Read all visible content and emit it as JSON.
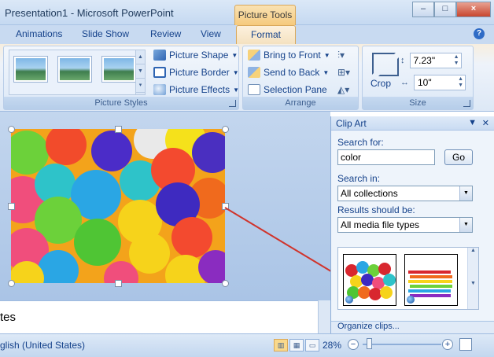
{
  "window": {
    "title": "Presentation1 - Microsoft PowerPoint",
    "context_tab": "Picture Tools",
    "controls": [
      "–",
      "□",
      "×"
    ]
  },
  "tabs": [
    "Animations",
    "Slide Show",
    "Review",
    "View",
    "Format"
  ],
  "active_tab": "Format",
  "ribbon": {
    "picture_styles": {
      "label": "Picture Styles",
      "buttons": [
        "Picture Shape",
        "Picture Border",
        "Picture Effects"
      ]
    },
    "arrange": {
      "label": "Arrange",
      "buttons": [
        "Bring to Front",
        "Send to Back",
        "Selection Pane"
      ]
    },
    "size": {
      "label": "Size",
      "crop_label": "Crop",
      "height_value": "7.23\"",
      "width_value": "10\""
    }
  },
  "notes_text": "tes",
  "clip_art": {
    "title": "Clip Art",
    "search_for_label": "Search for:",
    "search_value": "color",
    "go_label": "Go",
    "search_in_label": "Search in:",
    "search_in_value": "All collections",
    "results_label": "Results should be:",
    "results_value": "All media file types",
    "organize_label": "Organize clips..."
  },
  "status": {
    "language": "glish (United States)",
    "zoom": "28%"
  },
  "colors": {
    "accent": "#15428b",
    "context_tab": "#f6ca7d",
    "connector_line": "#d0342c"
  }
}
